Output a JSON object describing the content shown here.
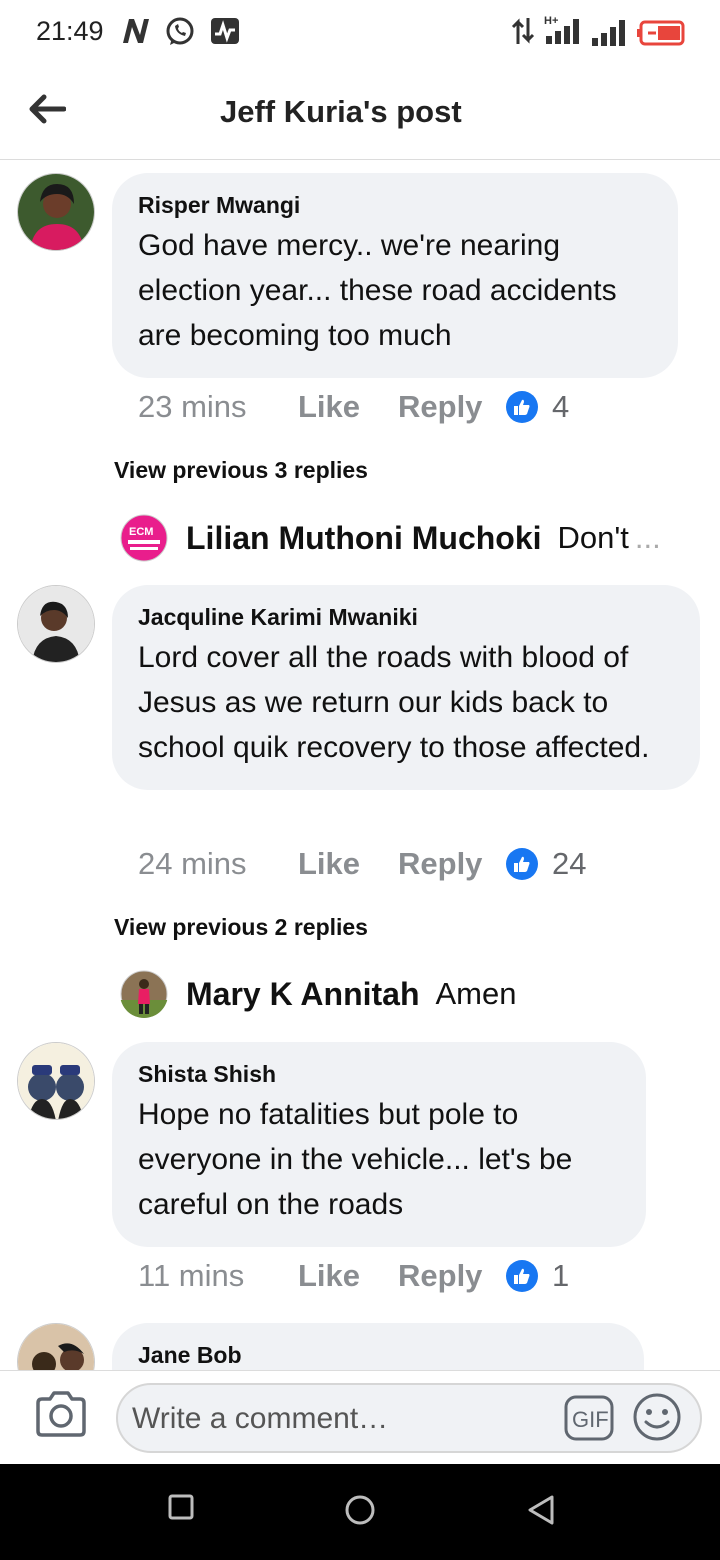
{
  "status_bar": {
    "time": "21:49",
    "left_icons": [
      "n-notification-icon",
      "whatsapp-icon",
      "activity-monitor-icon"
    ],
    "right_icons": [
      "data-transfer-icon",
      "hplus-signal-icon",
      "signal-icon",
      "battery-charging-icon"
    ],
    "network_label": "H+"
  },
  "header": {
    "title": "Jeff Kuria's post",
    "back_icon": "arrow-left-icon"
  },
  "comments": [
    {
      "author": "Risper Mwangi",
      "text": "God have mercy.. we're nearing election year... these road accidents are becoming too much",
      "time": "23 mins",
      "like_label": "Like",
      "reply_label": "Reply",
      "reactions": "4",
      "view_previous": "View previous 3 replies",
      "latest_reply": {
        "name": "Lilian Muthoni Muchoki",
        "text": "Don't",
        "more": "..."
      }
    },
    {
      "author": "Jacquline Karimi Mwaniki",
      "text": "Lord cover all the roads with blood of Jesus as we return our kids back to school quik recovery to those affected.",
      "time": "24 mins",
      "like_label": "Like",
      "reply_label": "Reply",
      "reactions": "24",
      "view_previous": "View previous 2 replies",
      "latest_reply": {
        "name": "Mary K Annitah",
        "text": "Amen"
      }
    },
    {
      "author": "Shista Shish",
      "text": "Hope no fatalities but pole to everyone in the vehicle... let's be careful on the roads",
      "time": "11 mins",
      "like_label": "Like",
      "reply_label": "Reply",
      "reactions": "1"
    },
    {
      "author": "Jane Bob"
    }
  ],
  "composer": {
    "placeholder": "Write a comment…",
    "gif_label": "GIF"
  },
  "colors": {
    "like_blue": "#1877f2",
    "bubble_bg": "#f0f2f5",
    "muted_text": "#8a8d91",
    "battery_red": "#e8453c"
  }
}
